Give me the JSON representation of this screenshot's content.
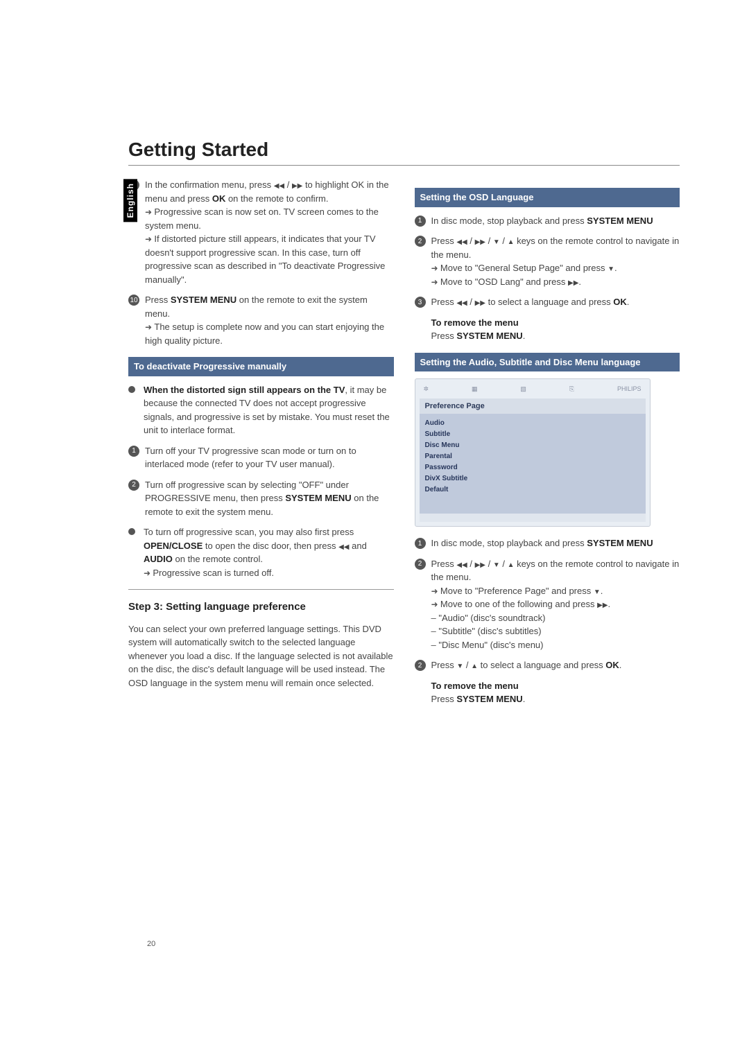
{
  "sidebar": {
    "language": "English"
  },
  "title": "Getting Started",
  "page_number": "20",
  "left": {
    "step9": "In the confirmation menu, press ",
    "step9b": " to highlight OK in the menu and press ",
    "ok": "OK",
    "step9c": " on the remote to confirm.",
    "arr1": "Progressive scan is now set on. TV screen comes to the system menu.",
    "arr2": "If distorted picture still appears, it indicates that your TV doesn't support progressive scan. In this case, turn off progressive scan as described in \"To deactivate Progressive manually\".",
    "step10a": "Press ",
    "sysmenu": "SYSTEM MENU",
    "step10b": " on the remote to exit the system menu.",
    "arr3": "The setup is complete now and you can start enjoying the high quality picture.",
    "bar1": "To deactivate Progressive manually",
    "bullet1a": "When the distorted sign still appears on the TV",
    "bullet1b": ", it may be because the connected TV does not accept progressive signals, and progressive is set by mistake. You must reset the unit to interlace format.",
    "s1": "Turn off your TV progressive scan mode or turn on to interlaced mode (refer to your TV user manual).",
    "s2a": "Turn off progressive scan by selecting \"OFF\" under PROGRESSIVE menu, then press ",
    "s2b": " on the remote to exit the system menu.",
    "bullet2a": "To turn off progressive scan, you may also first press ",
    "openclose": "OPEN/CLOSE",
    "bullet2b": " to open the disc door, then press ",
    "and": " and ",
    "audio": "AUDIO",
    "bullet2c": " on the remote control.",
    "arr4": "Progressive scan is turned off.",
    "h3": "Step 3: Setting language preference",
    "p": "You can select your own preferred language settings. This DVD system will automatically switch to the selected language whenever you load a disc. If the language selected is not available on the disc, the disc's default language will be used instead. The OSD language in the system menu will remain once selected."
  },
  "right": {
    "bar1": "Setting the OSD Language",
    "s1a": "In disc mode, stop playback and press ",
    "sysmenu": "SYSTEM MENU",
    "s2a1": "Press ",
    "s2a2": " keys on the remote control to navigate in the menu.",
    "arr1": "Move to \"General Setup Page\" and press ",
    "arr2": "Move to \"OSD Lang\" and press ",
    "s3a": "Press ",
    "s3b": " to select a language and press ",
    "ok": "OK",
    "remove_h": "To remove the menu",
    "remove_t": "Press ",
    "remove_t2": ".",
    "bar2": "Setting the Audio, Subtitle and Disc Menu language",
    "menu_tabs": {
      "t1": "✲",
      "t2": "▦",
      "t3": "▧",
      "t4": "⎘",
      "t5": "PHILIPS"
    },
    "menu_title": "Preference Page",
    "menu_items": [
      "Audio",
      "Subtitle",
      "Disc Menu",
      "Parental",
      "Password",
      "DivX Subtitle",
      "Default"
    ],
    "b1a": "In disc mode, stop playback and press ",
    "b2a1": "Press ",
    "b2a2": " keys on the remote control to navigate in the menu.",
    "barr1": "Move to \"Preference Page\" and press ",
    "barr2": "Move to one of the following and press ",
    "d1": "\"Audio\" (disc's soundtrack)",
    "d2": "\"Subtitle\" (disc's subtitles)",
    "d3": "\"Disc Menu\" (disc's menu)",
    "b3a": "Press ",
    "b3b": " to select a language and press ",
    "b3c": "."
  }
}
